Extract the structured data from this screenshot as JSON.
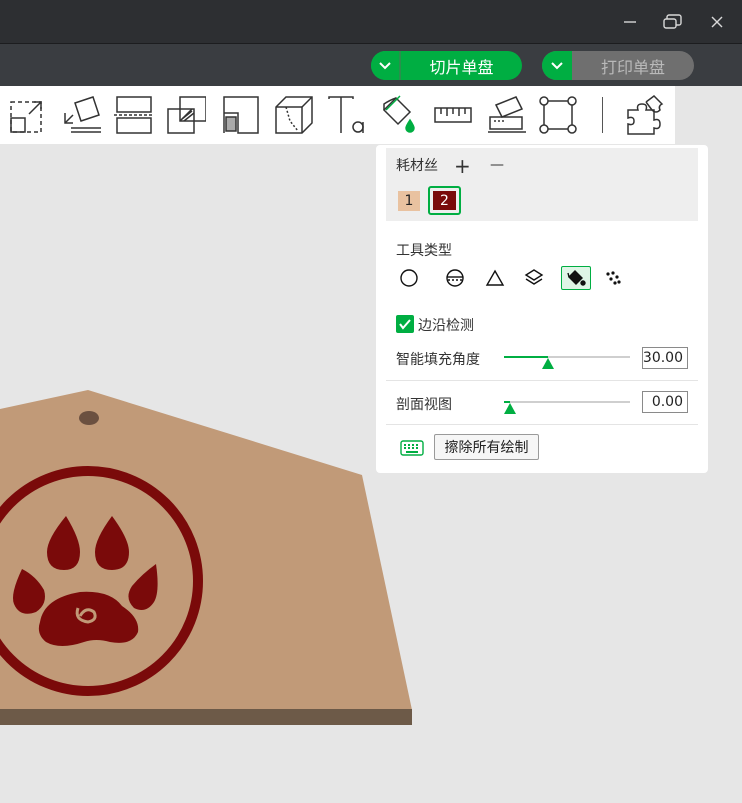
{
  "window": {
    "controls": [
      "minimize-icon",
      "restore-icon",
      "close-icon"
    ]
  },
  "actions": {
    "slice_label": "切片单盘",
    "print_label": "打印单盘"
  },
  "toolbar": {
    "tools": [
      "auto-orient-icon",
      "lay-on-face-icon",
      "cut-icon",
      "boolean-icon",
      "support-paint-icon",
      "seam-paint-icon",
      "text-icon",
      "color-paint-icon",
      "measure-icon",
      "assembly-icon",
      "scale-icon",
      "variable-layer-icon"
    ]
  },
  "panel": {
    "filament_title": "耗材丝",
    "add_symbol": "+",
    "remove_symbol": "—",
    "filaments": [
      {
        "label": "1",
        "color": "#e9c2a0",
        "text_color": "#222222",
        "selected": false
      },
      {
        "label": "2",
        "color": "#7a0a0a",
        "text_color": "#ffffff",
        "selected": true
      }
    ],
    "tool_type_label": "工具类型",
    "tool_types": [
      {
        "name": "circle-brush-icon",
        "active": false
      },
      {
        "name": "sphere-brush-icon",
        "active": false
      },
      {
        "name": "triangle-brush-icon",
        "active": false
      },
      {
        "name": "height-range-icon",
        "active": false
      },
      {
        "name": "fill-bucket-icon",
        "active": true
      },
      {
        "name": "gap-fill-icon",
        "active": false
      }
    ],
    "edge_detection_label": "边沿检测",
    "edge_detection_checked": true,
    "smart_fill_label": "智能填充角度",
    "smart_fill_value": "30.00",
    "smart_fill_fraction": 0.35,
    "section_view_label": "剖面视图",
    "section_view_value": "0.00",
    "section_view_fraction": 0.05,
    "erase_all_label": "擦除所有绘制",
    "accent_color": "#00ae42"
  },
  "model": {
    "plate_color": "#c19a78",
    "paint_color": "#7a0a0a"
  }
}
